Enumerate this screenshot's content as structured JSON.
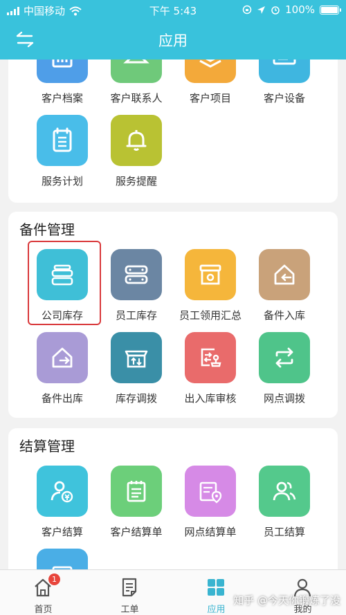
{
  "status_bar": {
    "carrier": "中国移动",
    "time": "下午 5:43",
    "battery": "100%"
  },
  "header": {
    "title": "应用"
  },
  "sections": [
    {
      "title": "",
      "items": [
        {
          "label": "客户档案",
          "icon": "customer-file-icon",
          "color": "#4f9ee8"
        },
        {
          "label": "客户联系人",
          "icon": "customer-contact-icon",
          "color": "#6fc97a"
        },
        {
          "label": "客户项目",
          "icon": "customer-project-icon",
          "color": "#f3a93a"
        },
        {
          "label": "客户设备",
          "icon": "customer-device-icon",
          "color": "#3fb6e0"
        },
        {
          "label": "服务计划",
          "icon": "service-plan-icon",
          "color": "#49bde9"
        },
        {
          "label": "服务提醒",
          "icon": "bell-icon",
          "color": "#b9c233"
        }
      ]
    },
    {
      "title": "备件管理",
      "items": [
        {
          "label": "公司库存",
          "icon": "company-stock-icon",
          "color": "#3fbfd7"
        },
        {
          "label": "员工库存",
          "icon": "staff-stock-icon",
          "color": "#6b86a3"
        },
        {
          "label": "员工领用汇总",
          "icon": "staff-collect-icon",
          "color": "#f5b63b"
        },
        {
          "label": "备件入库",
          "icon": "parts-inbound-icon",
          "color": "#c9a27a"
        },
        {
          "label": "备件出库",
          "icon": "parts-outbound-icon",
          "color": "#a99bd6"
        },
        {
          "label": "库存调拨",
          "icon": "stock-transfer-icon",
          "color": "#3a8fa7"
        },
        {
          "label": "出入库审核",
          "icon": "inout-audit-icon",
          "color": "#e96b6b"
        },
        {
          "label": "网点调拨",
          "icon": "branch-transfer-icon",
          "color": "#4fc48a"
        }
      ]
    },
    {
      "title": "结算管理",
      "items": [
        {
          "label": "客户结算",
          "icon": "customer-settle-icon",
          "color": "#3fc3dc"
        },
        {
          "label": "客户结算单",
          "icon": "customer-bill-icon",
          "color": "#6ccf7a"
        },
        {
          "label": "网点结算单",
          "icon": "branch-bill-icon",
          "color": "#d68ae6"
        },
        {
          "label": "员工结算",
          "icon": "staff-settle-icon",
          "color": "#54c98c"
        },
        {
          "label": "",
          "icon": "more-settle-icon",
          "color": "#4aaee6"
        }
      ]
    }
  ],
  "tabbar": {
    "tabs": [
      {
        "label": "首页",
        "icon": "home-icon",
        "badge": "1"
      },
      {
        "label": "工单",
        "icon": "work-order-icon"
      },
      {
        "label": "应用",
        "icon": "apps-icon",
        "active": true
      },
      {
        "label": "我的",
        "icon": "profile-icon"
      }
    ]
  },
  "watermark": "知乎 @今天你锻炼了没"
}
